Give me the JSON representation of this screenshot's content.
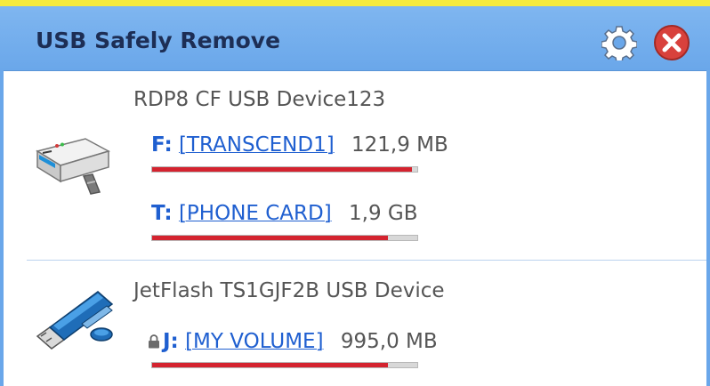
{
  "header": {
    "title": "USB Safely Remove",
    "settings_icon": "gear-icon",
    "close_icon": "close-icon"
  },
  "colors": {
    "header_bg": "#6aa7ea",
    "accent_strip": "#f6ea3c",
    "link_blue": "#1f5fd0",
    "usage_red": "#d4232f",
    "close_red": "#d8413c"
  },
  "devices": [
    {
      "name": "RDP8 CF USB Device123",
      "icon": "card-reader-icon",
      "volumes": [
        {
          "letter": "F:",
          "label": "[TRANSCEND1]",
          "size": "121,9 MB",
          "usage": 0.98,
          "locked": false
        },
        {
          "letter": "T:",
          "label": "[PHONE CARD]",
          "size": "1,9 GB",
          "usage": 0.89,
          "locked": false
        }
      ]
    },
    {
      "name": "JetFlash TS1GJF2B USB Device",
      "icon": "usb-flash-drive-icon",
      "volumes": [
        {
          "letter": "J:",
          "label": "[MY VOLUME]",
          "size": "995,0 MB",
          "usage": 0.89,
          "locked": true
        }
      ]
    }
  ]
}
